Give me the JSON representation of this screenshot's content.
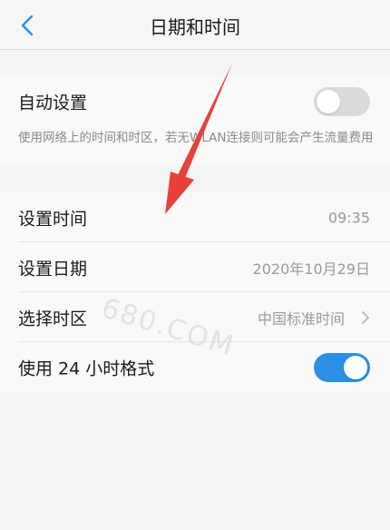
{
  "header": {
    "title": "日期和时间",
    "back_icon": "chevron-left-icon",
    "accent_color": "#2b8fe6"
  },
  "auto_setting": {
    "label": "自动设置",
    "toggle_state": "off",
    "description": "使用网络上的时间和时区，若无WLAN连接则可能会产生流量费用"
  },
  "settings": [
    {
      "label": "设置时间",
      "value": "09:35"
    },
    {
      "label": "设置日期",
      "value": "2020年10月29日"
    },
    {
      "label": "选择时区",
      "value": "中国标准时间",
      "chevron": "chevron-right-icon"
    },
    {
      "label": "使用 24 小时格式",
      "toggle_state": "on"
    }
  ],
  "watermark": "680.COM",
  "annotation_arrow_color": "#e8403a"
}
